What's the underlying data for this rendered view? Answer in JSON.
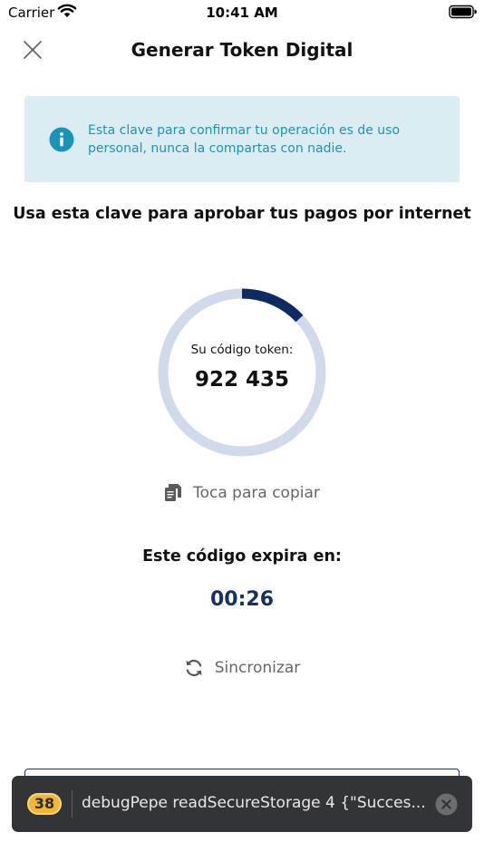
{
  "status_bar": {
    "carrier": "Carrier",
    "time": "10:41 AM"
  },
  "nav": {
    "title": "Generar Token Digital"
  },
  "info_box": {
    "text": "Esta clave para confirmar tu operación es de uso personal, nunca la compartas con nadie."
  },
  "instruction": "Usa esta clave para aprobar tus pagos por internet",
  "token": {
    "label": "Su código token:",
    "code": "922 435",
    "progress_fraction": 0.13
  },
  "copy": {
    "label": "Toca para copiar"
  },
  "expiry": {
    "label": "Este código expira en:",
    "time": "00:26"
  },
  "sync": {
    "label": "Sincronizar"
  },
  "toast": {
    "badge": "38",
    "message": "debugPepe readSecureStorage 4  {\"Succes..."
  },
  "icons": {
    "wifi": "wifi-icon",
    "battery": "battery-icon",
    "close": "close-icon",
    "info": "info-icon",
    "copy": "copy-icon",
    "sync": "sync-icon",
    "toast_close": "toast-close-icon"
  },
  "colors": {
    "info_background": "#dbedf3",
    "info_text": "#1a93b8",
    "ring_track": "#d1daea",
    "ring_progress": "#0f2a63",
    "timer": "#17305e",
    "toast_background": "#333437",
    "badge": "#f2b534"
  }
}
